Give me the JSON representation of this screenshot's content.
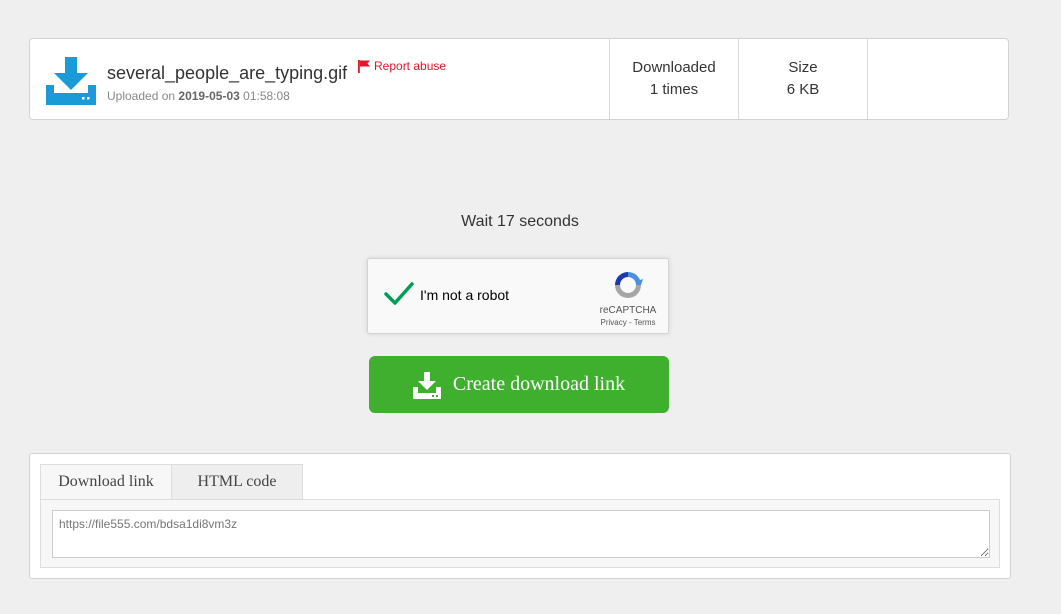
{
  "file": {
    "name": "several_people_are_typing.gif",
    "report_label": "Report abuse",
    "uploaded_prefix": "Uploaded on",
    "uploaded_date": "2019-05-03",
    "uploaded_time": "01:58:08",
    "icon": "download-icon",
    "icon_color": "#1a9ad6"
  },
  "stats": {
    "downloaded_label": "Downloaded",
    "downloaded_value": "1 times",
    "size_label": "Size",
    "size_value": "6 KB"
  },
  "wait": {
    "text": "Wait 17 seconds"
  },
  "recaptcha": {
    "label": "I'm not a robot",
    "brand": "reCAPTCHA",
    "links": "Privacy - Terms",
    "checked": true,
    "check_color": "#009e55"
  },
  "create_button": {
    "label": "Create download link",
    "color": "#3eb02e",
    "icon": "download-tray-icon"
  },
  "link_panel": {
    "tabs": [
      {
        "label": "Download link",
        "active": true
      },
      {
        "label": "HTML code",
        "active": false
      }
    ],
    "link_value": "https://file555.com/bdsa1di8vm3z"
  }
}
